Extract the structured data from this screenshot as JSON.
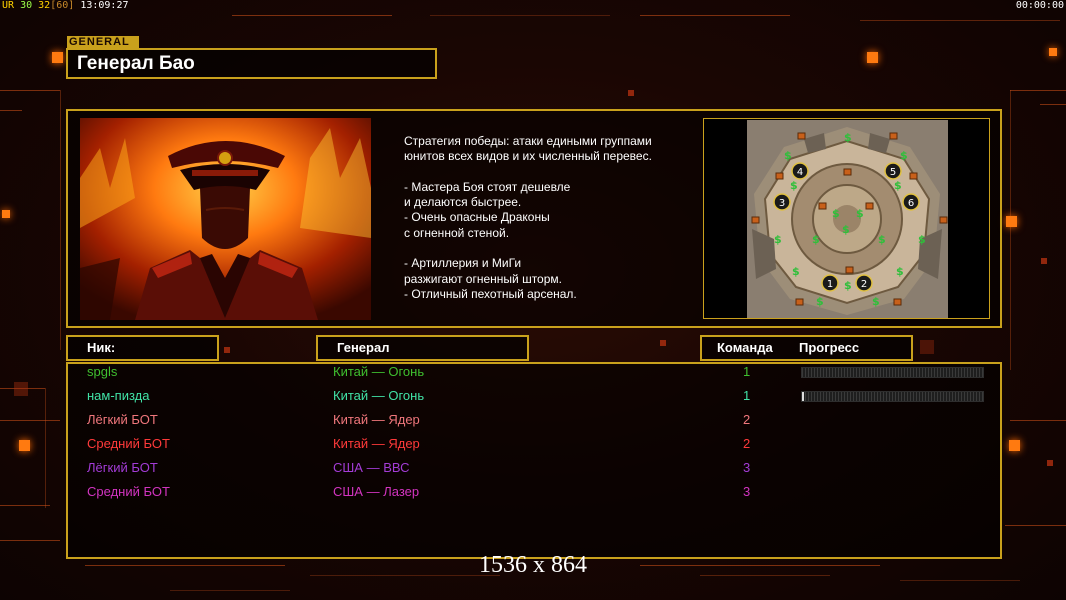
{
  "topbar": {
    "ur_label": "UR",
    "fps_a": "30",
    "fps_b": "32",
    "fps_c": "[60]",
    "clock": "13:09:27",
    "timer": "00:00:00"
  },
  "general_tag": "GENERAL",
  "general_name": "Генерал Бао",
  "description": "Стратегия победы: атаки едиными группами\nюнитов всех видов и их численный перевес.\n\n- Мастера Боя стоят дешевле\nи делаются быстрее.\n- Очень опасные Драконы\nс огненной стеной.\n\n- Артиллерия и МиГи\nразжигают огненный шторм.\n- Отличный пехотный арсенал.",
  "map": {
    "start_positions": [
      "1",
      "2",
      "3",
      "4",
      "5",
      "6"
    ]
  },
  "columns": {
    "nick": "Ник:",
    "general": "Генерал",
    "team": "Команда",
    "progress": "Прогресс"
  },
  "players": [
    {
      "nick": "spgls",
      "general": "Китай — Огонь",
      "team": "1",
      "progress": 0.0,
      "color": "#3fbf2f"
    },
    {
      "nick": "нам-пизда",
      "general": "Китай — Огонь",
      "team": "1",
      "progress": 0.01,
      "color": "#41e2a6"
    },
    {
      "nick": "Лёгкий БОТ",
      "general": "Китай — Ядер",
      "team": "2",
      "progress": null,
      "color": "#f0777c"
    },
    {
      "nick": "Средний БОТ",
      "general": "Китай — Ядер",
      "team": "2",
      "progress": null,
      "color": "#ff3a3a"
    },
    {
      "nick": "Лёгкий БОТ",
      "general": "США — ВВС",
      "team": "3",
      "progress": null,
      "color": "#a33cd6"
    },
    {
      "nick": "Средний БОТ",
      "general": "США — Лазер",
      "team": "3",
      "progress": null,
      "color": "#d234c0"
    }
  ],
  "resolution": "1536 x 864",
  "colors": {
    "accent_gold": "#c9a11c",
    "accent_orange": "#ff7a10"
  }
}
